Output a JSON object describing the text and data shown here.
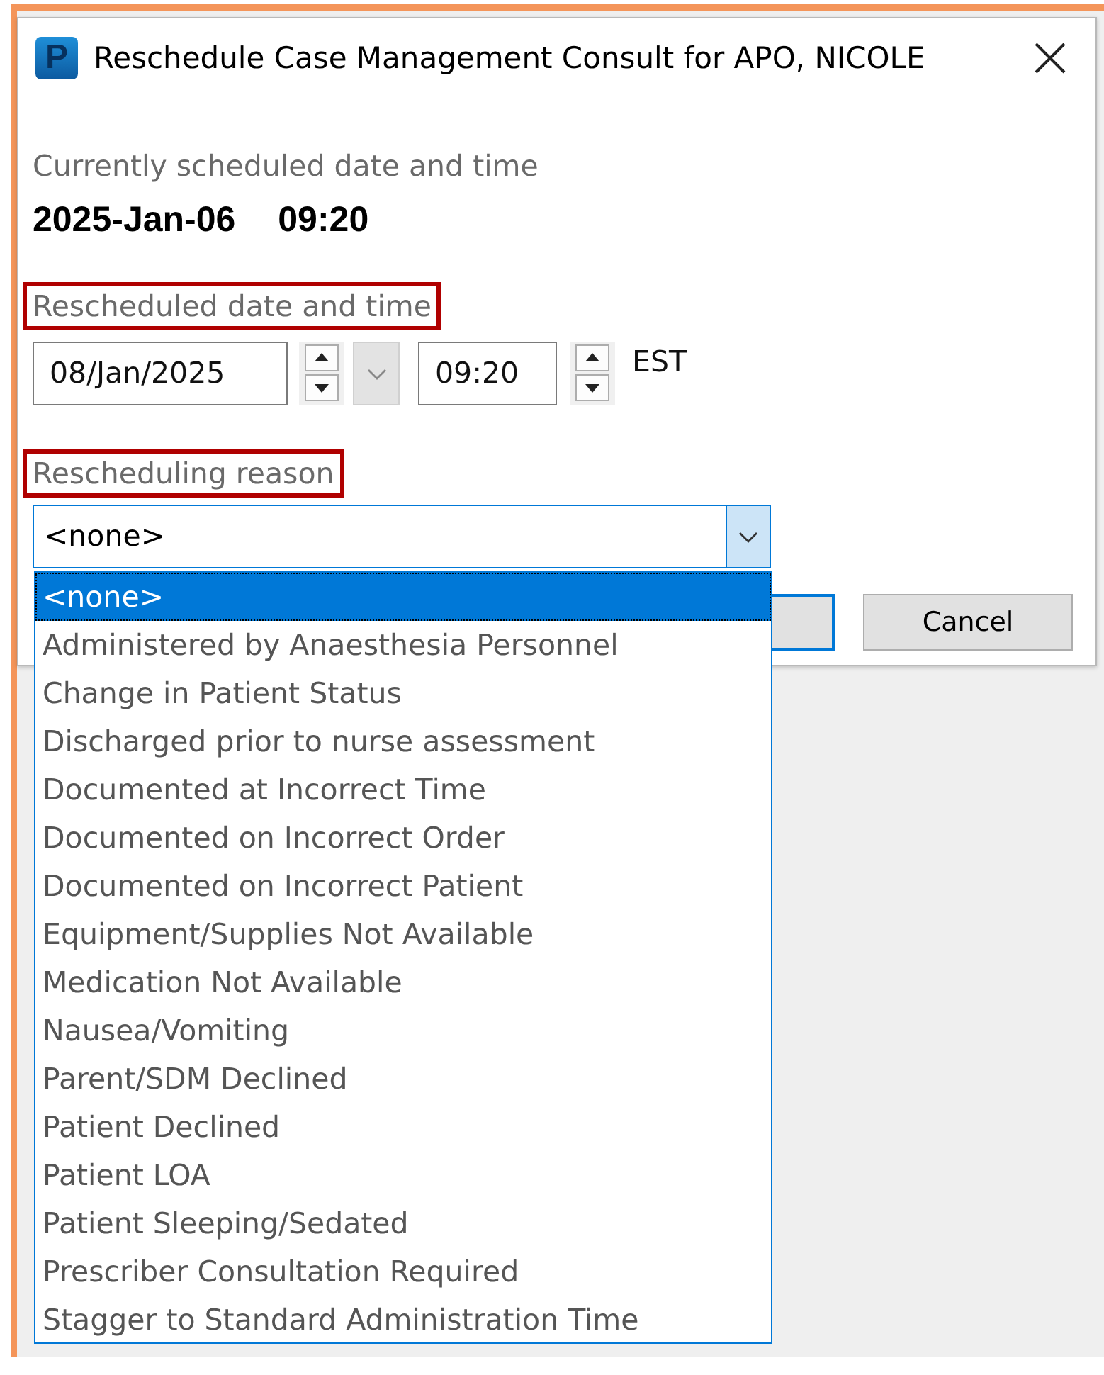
{
  "window": {
    "icon_letter": "P",
    "title": "Reschedule Case Management Consult for APO, NICOLE"
  },
  "current": {
    "label": "Currently scheduled date and time",
    "date": "2025-Jan-06",
    "time": "09:20"
  },
  "rescheduled": {
    "label": "Rescheduled date and time",
    "highlighted": true,
    "date": "08/Jan/2025",
    "time": "09:20",
    "timezone": "EST"
  },
  "reason": {
    "label": "Rescheduling reason",
    "highlighted": true,
    "value": "<none>",
    "expanded": true,
    "options": [
      {
        "label": "<none>",
        "selected": true
      },
      {
        "label": "Administered by Anaesthesia Personnel",
        "selected": false
      },
      {
        "label": "Change in Patient Status",
        "selected": false
      },
      {
        "label": "Discharged prior to nurse assessment",
        "selected": false
      },
      {
        "label": "Documented at Incorrect Time",
        "selected": false
      },
      {
        "label": "Documented on Incorrect Order",
        "selected": false
      },
      {
        "label": "Documented on Incorrect Patient",
        "selected": false
      },
      {
        "label": "Equipment/Supplies Not Available",
        "selected": false
      },
      {
        "label": "Medication Not Available",
        "selected": false
      },
      {
        "label": "Nausea/Vomiting",
        "selected": false
      },
      {
        "label": "Parent/SDM Declined",
        "selected": false
      },
      {
        "label": "Patient Declined",
        "selected": false
      },
      {
        "label": "Patient LOA",
        "selected": false
      },
      {
        "label": "Patient Sleeping/Sedated",
        "selected": false
      },
      {
        "label": "Prescriber Consultation Required",
        "selected": false
      },
      {
        "label": "Stagger to Standard Administration Time",
        "selected": false
      }
    ]
  },
  "buttons": [
    {
      "kind": "default"
    },
    {
      "kind": "normal",
      "label": "Cancel"
    }
  ]
}
